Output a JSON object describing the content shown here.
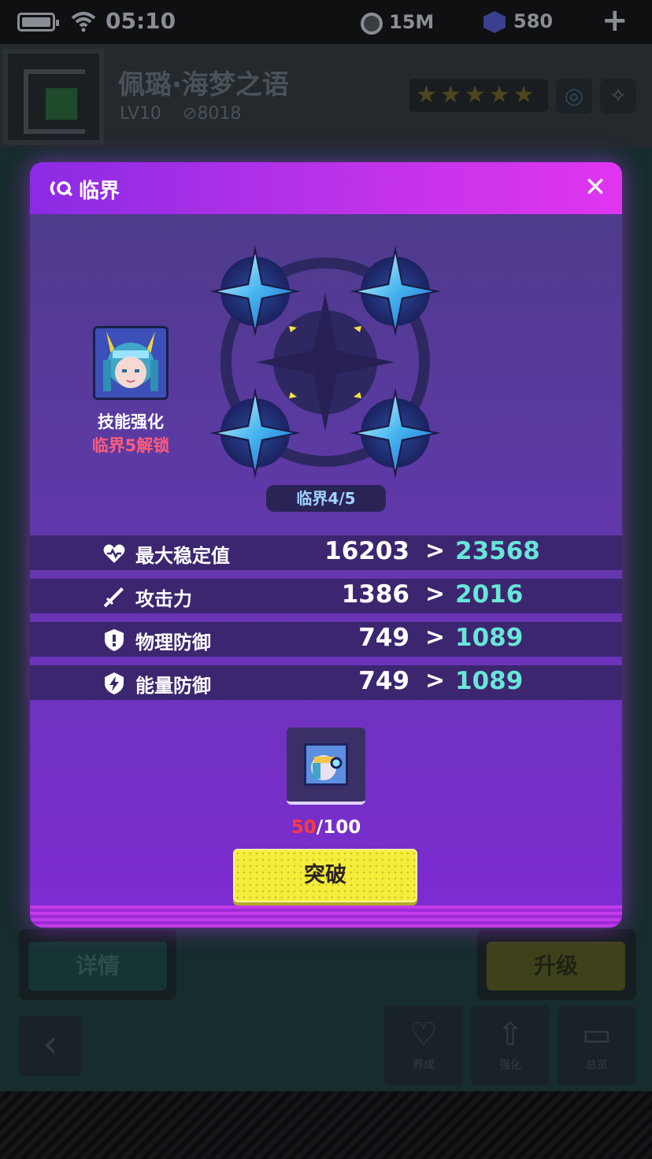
{
  "status_bar": {
    "time": "05:10",
    "coins": "15M",
    "gems": "580"
  },
  "background": {
    "character_name": "佩璐·海梦之语",
    "level": "LV10",
    "power": "8018",
    "stars": "★★★★★",
    "detail_button": "详情",
    "upgrade_button": "升级",
    "nav_tabs": [
      {
        "label": "养成"
      },
      {
        "label": "强化"
      },
      {
        "label": "总览"
      }
    ]
  },
  "modal": {
    "title": "临界",
    "skill_reward": {
      "label": "技能强化",
      "unlock_text": "临界5解锁"
    },
    "critical_level": "临界4/5",
    "stats": [
      {
        "icon": "heart-icon",
        "name": "最大稳定值",
        "current": "16203",
        "next": "23568"
      },
      {
        "icon": "sword-icon",
        "name": "攻击力",
        "current": "1386",
        "next": "2016"
      },
      {
        "icon": "shield-icon",
        "name": "物理防御",
        "current": "749",
        "next": "1089"
      },
      {
        "icon": "energy-shield-icon",
        "name": "能量防御",
        "current": "749",
        "next": "1089"
      }
    ],
    "material": {
      "have": "50",
      "need": "/100"
    },
    "breakthrough_button": "突破"
  },
  "colors": {
    "accent_teal": "#68e6d8",
    "lock_red": "#ff5c7c",
    "button_yellow": "#f5ec3b"
  }
}
